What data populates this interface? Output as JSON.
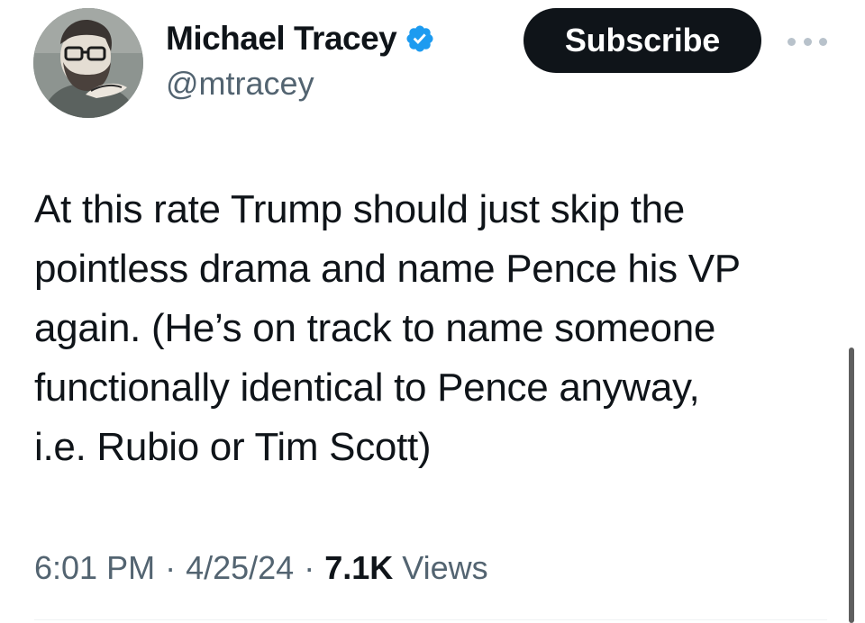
{
  "author": {
    "display_name": "Michael Tracey",
    "handle": "@mtracey",
    "verified": true,
    "avatar_icon": "avatar-illustration-icon"
  },
  "actions": {
    "subscribe_label": "Subscribe",
    "more_icon": "more-horizontal-icon"
  },
  "tweet": {
    "lines": [
      "At this rate Trump should just skip the",
      "pointless drama and name Pence his VP",
      "again. (He’s on track to name someone",
      "functionally identical to Pence anyway,",
      "i.e. Rubio or Tim Scott)"
    ]
  },
  "meta": {
    "time": "6:01 PM",
    "separator": "·",
    "date": "4/25/24",
    "views_count": "7.1K",
    "views_label": "Views"
  },
  "colors": {
    "text_primary": "#0f1419",
    "text_secondary": "#536471",
    "verified_blue": "#1d9bf0",
    "button_bg": "#0f1419"
  }
}
